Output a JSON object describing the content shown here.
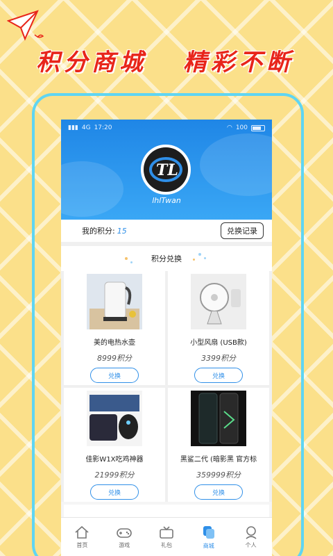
{
  "promo": {
    "left_slogan": "积分商城",
    "right_slogan": "精彩不断",
    "plane_icon": "paper-plane-icon",
    "slogan_color": "#e8251a"
  },
  "status_bar": {
    "carrier": "4G",
    "time": "17:20",
    "battery": "100"
  },
  "profile": {
    "logo_text": "TL",
    "username": "lhlTwan"
  },
  "points": {
    "label": "我的积分:",
    "value": "15",
    "record_button": "兑换记录"
  },
  "section": {
    "title": "积分兑换"
  },
  "products": [
    {
      "name": "美的电热水壶",
      "price": "8999积分",
      "button": "兑换",
      "icon": "kettle-icon"
    },
    {
      "name": "小型风扇 (USB款)",
      "price": "3399积分",
      "button": "兑换",
      "icon": "fan-icon"
    },
    {
      "name": "佳影W1X吃鸡神器",
      "price": "21999积分",
      "button": "兑换",
      "icon": "gamepad-keyboard-icon"
    },
    {
      "name": "黑鲨二代 (暗影黑 官方标",
      "price": "359999积分",
      "button": "兑换",
      "icon": "phone-icon"
    }
  ],
  "tabbar": {
    "items": [
      {
        "label": "首页",
        "icon": "home-icon"
      },
      {
        "label": "游戏",
        "icon": "gamepad-icon"
      },
      {
        "label": "礼包",
        "icon": "gift-tv-icon"
      },
      {
        "label": "商城",
        "icon": "shop-icon"
      },
      {
        "label": "个人",
        "icon": "person-icon"
      }
    ],
    "active_index": 3
  },
  "colors": {
    "accent": "#2f8fe8",
    "background": "#fbe08a",
    "frame": "#5fd5f3"
  }
}
